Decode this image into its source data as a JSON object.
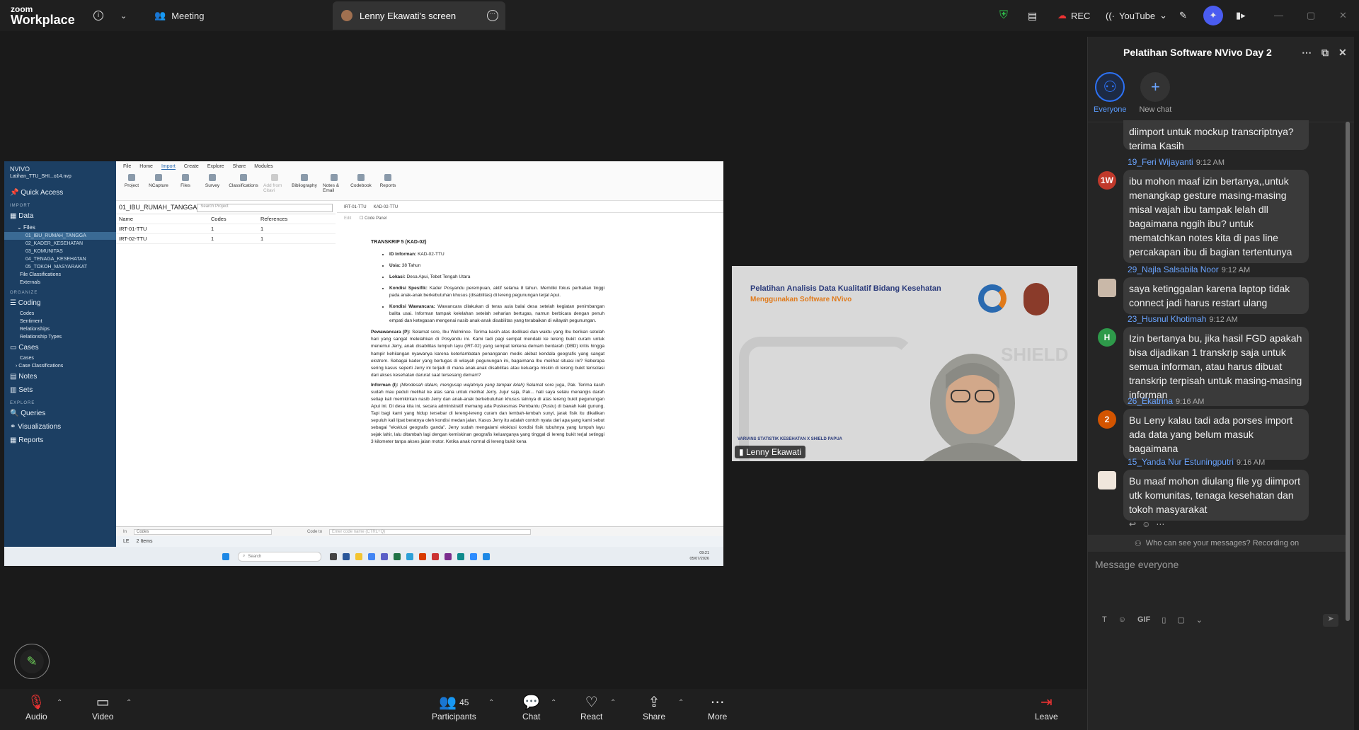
{
  "topbar": {
    "logo_line1": "zoom",
    "logo_line2": "Workplace",
    "meeting_label": "Meeting",
    "screen_tab_label": "Lenny Ekawati's screen",
    "rec_label": "REC",
    "youtube_label": "YouTube"
  },
  "nvivo": {
    "brand": "NVIVO",
    "project_file": "Latihan_TTU_SHI...o14.nvp",
    "quick_access": "Quick Access",
    "import_section": "IMPORT",
    "data_label": "Data",
    "files_label": "Files",
    "file_folders": [
      "01_IBU_RUMAH_TANGGA",
      "02_KADER_KESEHATAN",
      "03_KOMUNITAS",
      "04_TENAGA_KESEHATAN",
      "05_TOKOH_MASYARAKAT"
    ],
    "file_classifications": "File Classifications",
    "externals": "Externals",
    "organize_section": "ORGANIZE",
    "coding_label": "Coding",
    "coding_items": [
      "Codes",
      "Sentiment",
      "Relationships",
      "Relationship Types"
    ],
    "cases_label": "Cases",
    "cases_items": [
      "Cases",
      "Case Classifications"
    ],
    "notes_label": "Notes",
    "sets_label": "Sets",
    "explore_section": "EXPLORE",
    "queries_label": "Queries",
    "visualizations_label": "Visualizations",
    "reports_label": "Reports",
    "menu": [
      "File",
      "Home",
      "Import",
      "Create",
      "Explore",
      "Share",
      "Modules"
    ],
    "ribbon": [
      "Project",
      "NCapture",
      "Files",
      "Survey",
      "Classifications",
      "Add from Citavi",
      "Bibliography",
      "Notes & Email",
      "Codebook",
      "Reports"
    ],
    "folder_title": "01_IBU_RUMAH_TANGGA",
    "search_placeholder": "Search Project",
    "columns": [
      "Name",
      "Codes",
      "References"
    ],
    "rows": [
      {
        "name": "IRT-01-TTU",
        "codes": "1",
        "refs": "1"
      },
      {
        "name": "IRT-02-TTU",
        "codes": "1",
        "refs": "1"
      }
    ],
    "doc_tabs": [
      "IRT-01-TTU",
      "KAD-02-TTU"
    ],
    "doc_tools": [
      "Edit",
      "Code Panel"
    ],
    "doc_title": "TRANSKRIP 5 (KAD-02)",
    "bullets": [
      {
        "label": "ID Informan:",
        "text": " KAD-02-TTU"
      },
      {
        "label": "Usia:",
        "text": " 38 Tahun"
      },
      {
        "label": "Lokasi:",
        "text": " Desa Apui, Tebet Tengah Utara"
      },
      {
        "label": "Kondisi Spesifik:",
        "text": " Kader Posyandu perempuan, aktif selama 8 tahun. Memiliki fokus perhatian tinggi pada anak-anak berkebutuhan khusus (disabilitas) di lereng pegunungan terjal Apui."
      },
      {
        "label": "Kondisi Wawancara:",
        "text": " Wawancara dilakukan di teras aula balai desa setelah kegiatan penimbangan balita usai. Informan tampak kelelahan setelah seharian bertugas, namun berbicara dengan penuh empati dan ketegasan mengenai nasib anak-anak disabilitas yang terabaikan di wilayah pegunungan."
      }
    ],
    "para1_label": "Pewawancara (P):",
    "para1": " Selamat sore, Ibu Welmince. Terima kasih atas dedikasi dan waktu yang Ibu berikan setelah hari yang sangat melelahkan di Posyandu ini. Kami tadi pagi sempat mendaki ke lereng bukit curam untuk menemui Jerry, anak disabilitas lumpuh layu (IRT-02) yang sempat terkena demam berdarah (DBD) kritis hingga hampir kehilangan nyawanya karena keterlambatan penanganan medis akibat kendala geografis yang sangat ekstrem. Sebagai kader yang bertugas di wilayah pegunungan ini, bagaimana Ibu melihat situasi ini? Seberapa sering kasus seperti Jerry ini terjadi di mana anak-anak disabilitas atau keluarga miskin di lereng bukit terisolasi dari akses kesehatan darurat saat tersesang demam?",
    "para2_label": "Informan (I):",
    "para2_italic": " (Mendesah dalam, mengusap wajahnya yang tampak lelah)",
    "para2": " Selamat sore juga, Pak. Terima kasih sudah mau peduli melihat ke atas sana untuk melihat Jerry. Jujur saja, Pak... hati saya selalu menangis darah setiap kali memikirkan nasib Jerry dan anak-anak berkebutuhan khusus lainnya di atas lereng bukit pegunungan Apui ini. Di desa kita ini, secara administratif memang ada Puskesmas Pembantu (Pustu) di bawah kaki gunung. Tapi bagi kami yang hidup tersebar di lereng-lereng curam dan lembah-lembah sunyi, jarak fisik itu dikalikan sepuluh kali lipat beratnya oleh kondisi medan jalan. Kasus Jerry itu adalah contoh nyata dari apa yang kami sebut sebagai \"eksklusi geografis ganda\". Jerry sudah mengalami eksklusi kondisi fisik tubuhnya yang lumpuh layu sejak lahir, lalu ditambah lagi dengan kemiskinan geografis keluarganya yang tinggal di lereng bukit terjal setinggi 3 kilometer tanpa akses jalan motor. Ketika anak normal di lereng bukit kena",
    "codebar_in": "In",
    "codebar_codes": "Codes",
    "codebar_codeto": "Code to",
    "codebar_placeholder": "Enter code name (CTRL+Q)",
    "status_user": "LE",
    "status_items": "2 Items",
    "taskbar_search": "Search",
    "clock_time": "09:21",
    "clock_date": "05/07/2026"
  },
  "video": {
    "title1": "Pelatihan Analisis Data Kualitatif Bidang Kesehatan",
    "title2": "Menggunakan Software NVivo",
    "footer": "VARIANS STATISTIK KESEHATAN X SHIELD PAPUA",
    "name": "Lenny Ekawati",
    "watermark": "SHIELD"
  },
  "bottombar": {
    "audio": "Audio",
    "video": "Video",
    "participants": "Participants",
    "participants_count": "45",
    "chat": "Chat",
    "react": "React",
    "share": "Share",
    "more": "More",
    "leave": "Leave"
  },
  "chat": {
    "title": "Pelatihan Software NVivo Day 2",
    "tab_everyone": "Everyone",
    "tab_new": "New chat",
    "partial_text": "diimport untuk mockup transcriptnya? terima Kasih",
    "messages": [
      {
        "name": "19_Feri Wijayanti",
        "time": "9:12 AM",
        "initials": "1W",
        "text": "ibu mohon maaf izin bertanya,,untuk menangkap gesture masing-masing misal wajah ibu tampak lelah dll bagaimana nggih ibu? untuk mematchkan notes kita di pas line percakapan ibu di bagian tertentunya"
      },
      {
        "name": "29_Najla Salsabila Noor",
        "time": "9:12 AM",
        "initials": "",
        "text": "saya ketinggalan karena laptop tidak connect jadi harus restart ulang"
      },
      {
        "name": "23_Husnul Khotimah",
        "time": "9:12 AM",
        "initials": "H",
        "text": "Izin bertanya bu, jika hasil FGD apakah bisa dijadikan 1 transkrip saja untuk semua informan, atau harus dibuat transkrip terpisah untuk masing-masing informan"
      },
      {
        "name": "26_Ekatrina",
        "time": "9:16 AM",
        "initials": "2",
        "text": "Bu Leny kalau tadi ada porses import ada data yang belum masuk bagaimana"
      },
      {
        "name": "15_Yanda Nur Estuningputri",
        "time": "9:16 AM",
        "initials": "",
        "text": "Bu maaf mohon diulang file yg diimport utk komunitas, tenaga kesehatan dan tokoh masyarakat"
      }
    ],
    "visibility_note": "Who can see your messages? Recording on",
    "input_placeholder": "Message everyone",
    "gif_label": "GIF"
  }
}
